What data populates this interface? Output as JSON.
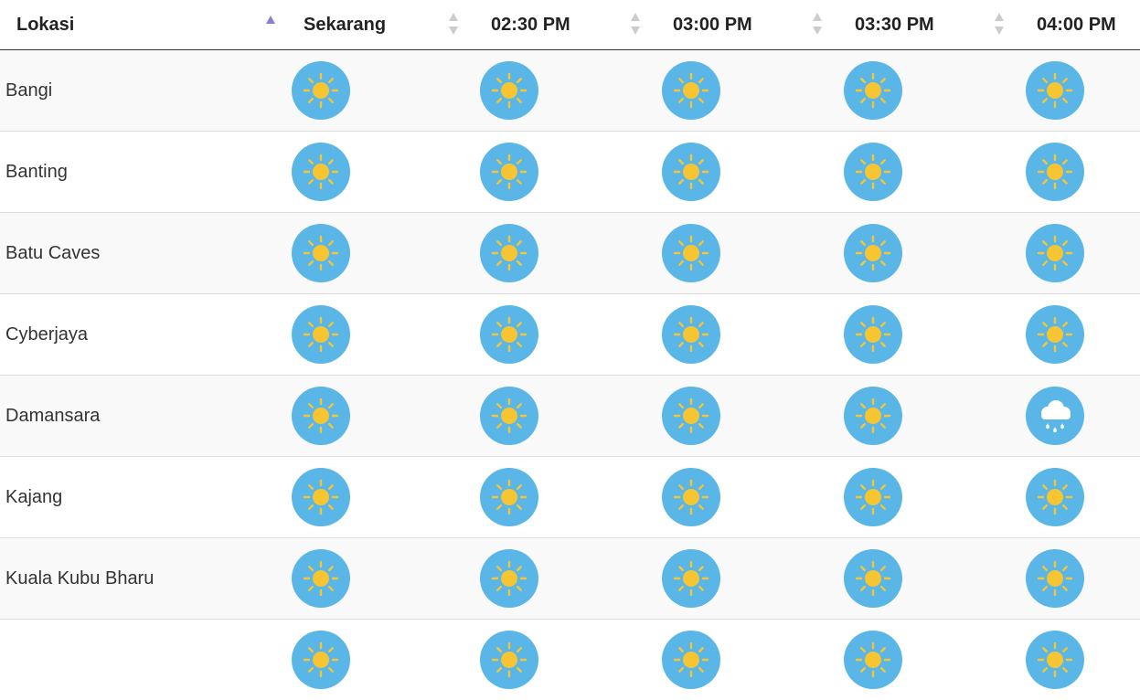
{
  "table": {
    "headers": [
      {
        "label": "Lokasi",
        "sort": "asc"
      },
      {
        "label": "Sekarang",
        "sort": "both"
      },
      {
        "label": "02:30 PM",
        "sort": "both"
      },
      {
        "label": "03:00 PM",
        "sort": "both"
      },
      {
        "label": "03:30 PM",
        "sort": "both"
      },
      {
        "label": "04:00 PM",
        "sort": "both"
      }
    ],
    "rows": [
      {
        "location": "Bangi",
        "forecast": [
          "sun-icon",
          "sun-icon",
          "sun-icon",
          "sun-icon",
          "sun-icon"
        ]
      },
      {
        "location": "Banting",
        "forecast": [
          "sun-icon",
          "sun-icon",
          "sun-icon",
          "sun-icon",
          "sun-icon"
        ]
      },
      {
        "location": "Batu Caves",
        "forecast": [
          "sun-icon",
          "sun-icon",
          "sun-icon",
          "sun-icon",
          "sun-icon"
        ]
      },
      {
        "location": "Cyberjaya",
        "forecast": [
          "sun-icon",
          "sun-icon",
          "sun-icon",
          "sun-icon",
          "sun-icon"
        ]
      },
      {
        "location": "Damansara",
        "forecast": [
          "sun-icon",
          "sun-icon",
          "sun-icon",
          "sun-icon",
          "rain-cloud-icon"
        ]
      },
      {
        "location": "Kajang",
        "forecast": [
          "sun-icon",
          "sun-icon",
          "sun-icon",
          "sun-icon",
          "sun-icon"
        ]
      },
      {
        "location": "Kuala Kubu Bharu",
        "forecast": [
          "sun-icon",
          "sun-icon",
          "sun-icon",
          "sun-icon",
          "sun-icon"
        ]
      },
      {
        "location": "",
        "forecast": [
          "sun-icon",
          "sun-icon",
          "sun-icon",
          "sun-icon",
          "sun-icon"
        ]
      }
    ]
  },
  "colors": {
    "icon_background": "#5bb6e8",
    "sun": "#f7c531",
    "cloud": "#ffffff",
    "row_stripe": "#f9f9f9",
    "sort_active": "#8a7fd6",
    "sort_inactive": "#cccccc"
  }
}
